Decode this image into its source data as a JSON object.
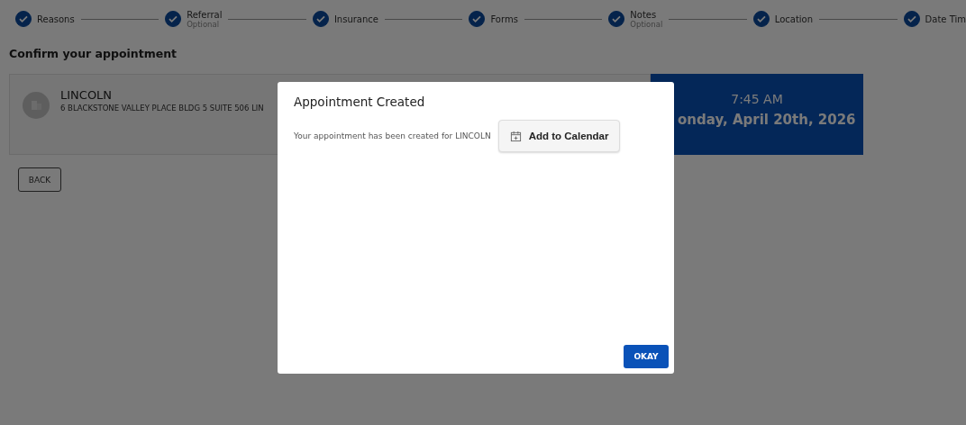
{
  "stepper": [
    {
      "label": "Reasons",
      "completed": true
    },
    {
      "label": "Referral",
      "sublabel": "Optional",
      "completed": true
    },
    {
      "label": "Insurance",
      "completed": true
    },
    {
      "label": "Forms",
      "completed": true
    },
    {
      "label": "Notes",
      "sublabel": "Optional",
      "completed": true
    },
    {
      "label": "Location",
      "completed": true
    },
    {
      "label": "Date Tim",
      "completed": true
    }
  ],
  "heading": "Confirm your appointment",
  "location": {
    "name": "LINCOLN",
    "address": "6 BLACKSTONE VALLEY PLACE BLDG 5 SUITE 506 LIN"
  },
  "slot": {
    "time": "7:45 AM",
    "date": "onday, April 20th, 2026"
  },
  "back_button": "BACK",
  "dialog": {
    "title": "Appointment Created",
    "message": "Your appointment has been created for LINCOLN",
    "calendar_button": "Add to Calendar",
    "okay_button": "OKAY"
  }
}
